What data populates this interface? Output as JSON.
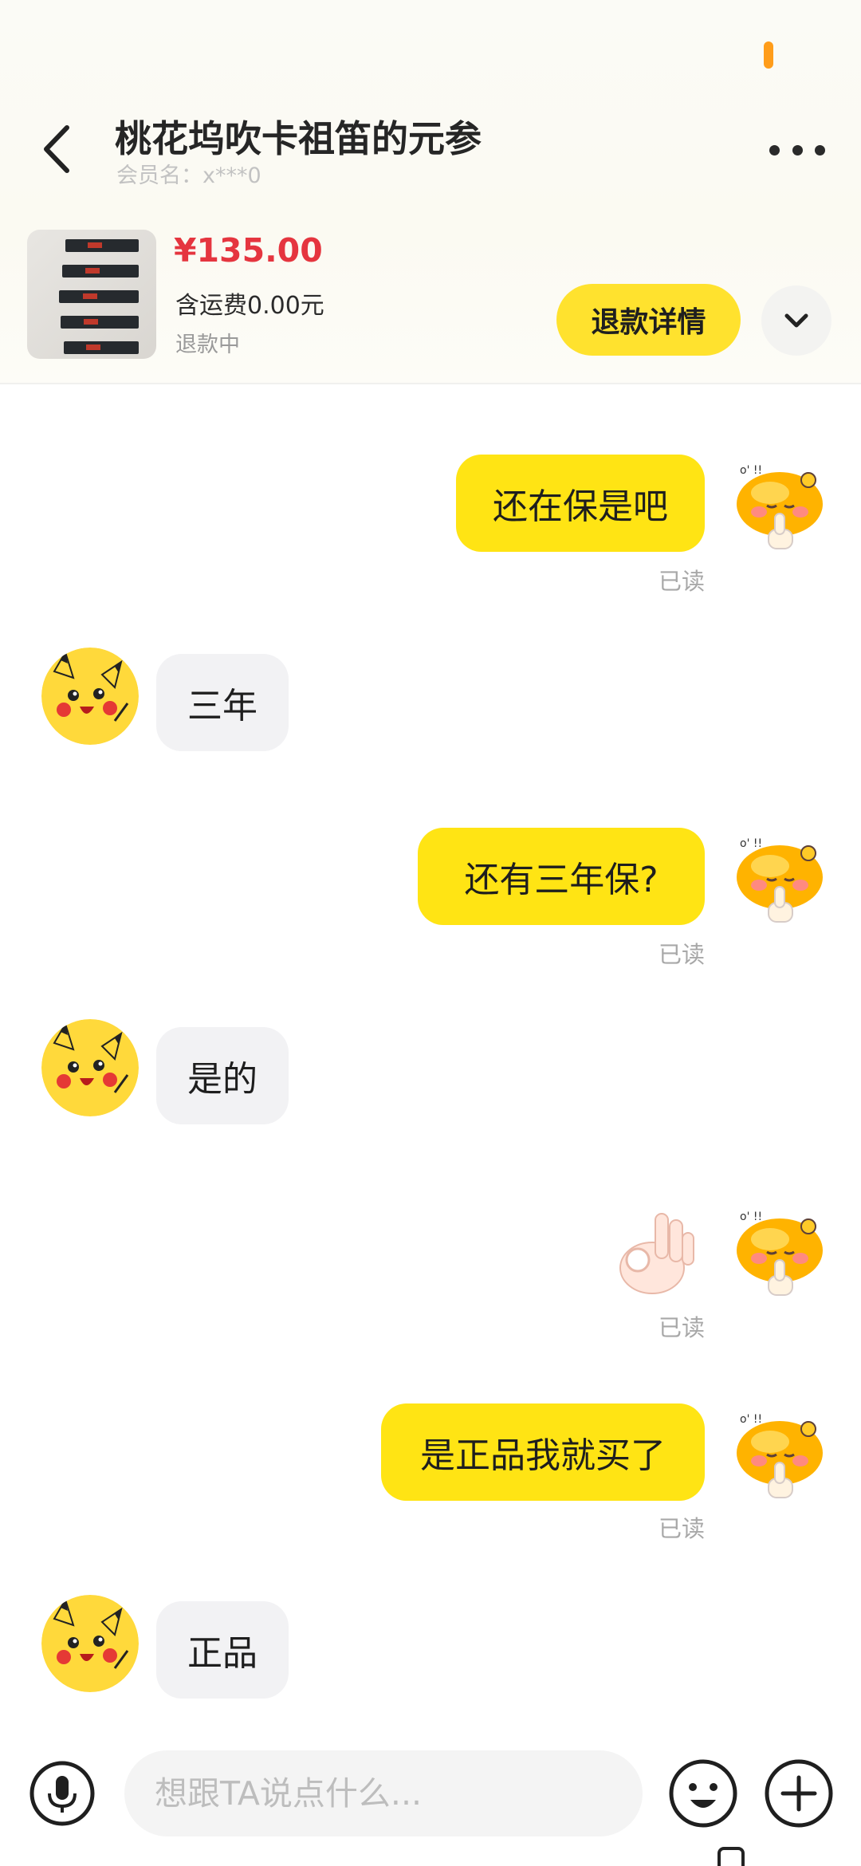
{
  "header": {
    "title": "桃花坞吹卡祖笛的元参",
    "member_label": "会员名：x***0",
    "back_icon": "chevron-left-icon",
    "more_icon": "more-dots-icon"
  },
  "order": {
    "price": "¥135.00",
    "shipping": "含运费0.00元",
    "status": "退款中",
    "refund_button": "退款详情",
    "expand_icon": "chevron-down-icon"
  },
  "messages": [
    {
      "from": "me",
      "text": "还在保是吧",
      "read": "已读"
    },
    {
      "from": "them",
      "text": "三年"
    },
    {
      "from": "me",
      "text": "还有三年保?",
      "read": "已读"
    },
    {
      "from": "them",
      "text": "是的"
    },
    {
      "from": "me",
      "sticker": "ok-hand",
      "read": "已读"
    },
    {
      "from": "me",
      "text": "是正品我就买了",
      "read": "已读"
    },
    {
      "from": "them",
      "text": "正品"
    }
  ],
  "input": {
    "placeholder": "想跟TA说点什么...",
    "mic_icon": "microphone-icon",
    "emoji_icon": "smiley-icon",
    "plus_icon": "plus-icon"
  },
  "colors": {
    "accent_yellow": "#ffe414",
    "price_red": "#e5353f",
    "status_orange": "#ff9d1a"
  }
}
